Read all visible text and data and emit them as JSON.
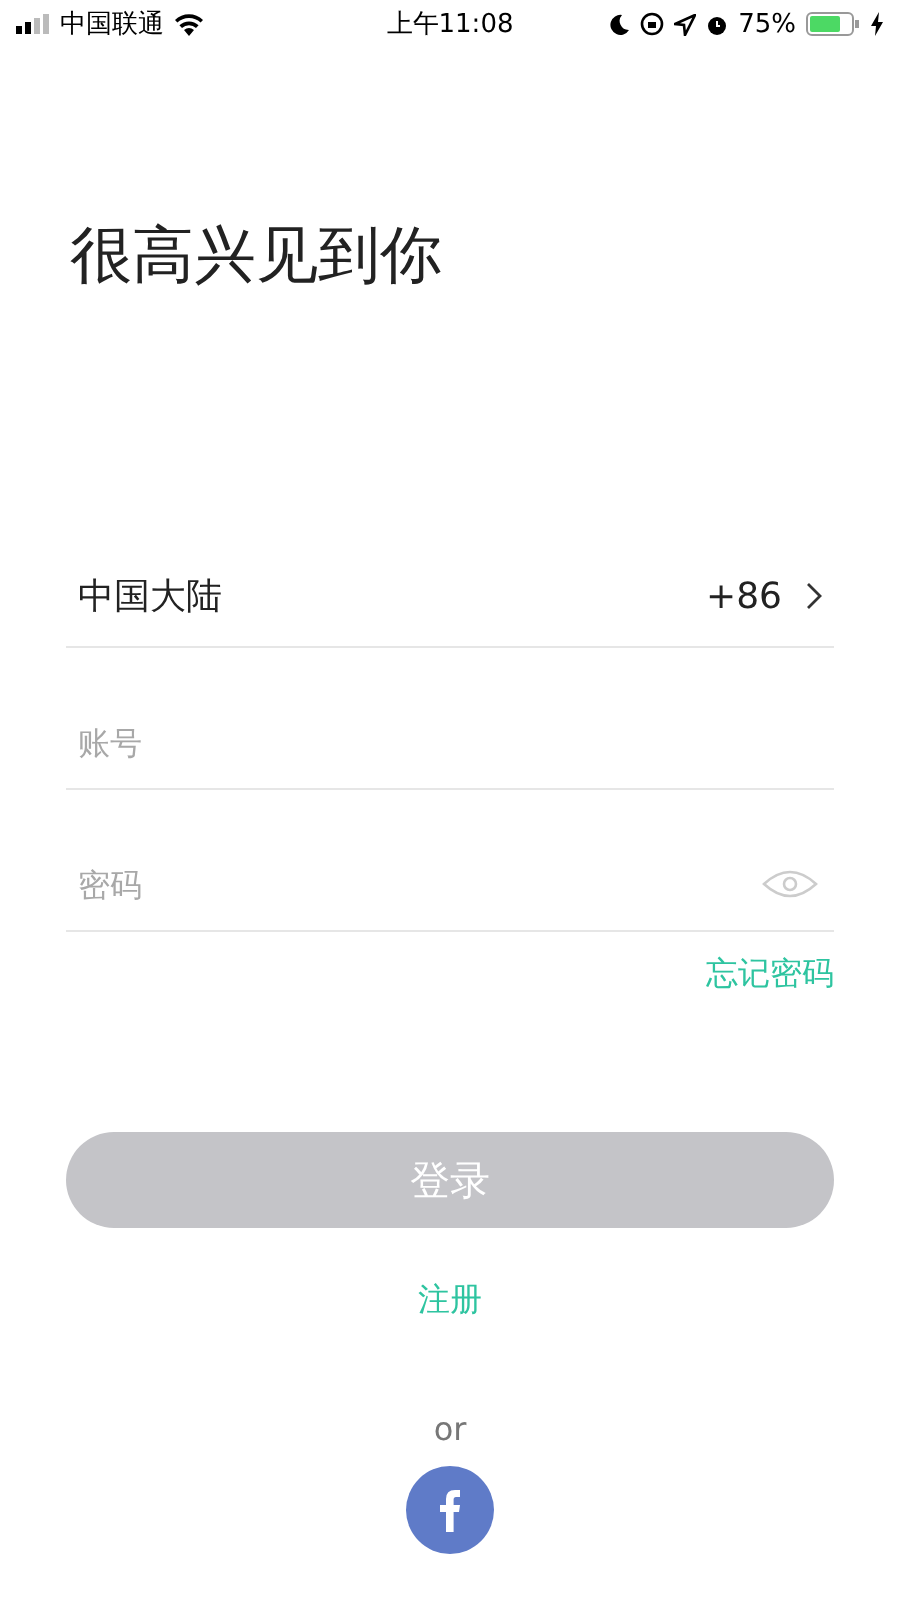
{
  "status_bar": {
    "carrier": "中国联通",
    "time": "上午11:08",
    "battery": "75%"
  },
  "title": "很高兴见到你",
  "country": {
    "name": "中国大陆",
    "code": "+86"
  },
  "account_field": {
    "placeholder": "账号"
  },
  "password_field": {
    "placeholder": "密码"
  },
  "forgot_link": "忘记密码",
  "login_button": {
    "label": "登录",
    "disabled": true
  },
  "register_link": "注册",
  "divider_text": "or"
}
